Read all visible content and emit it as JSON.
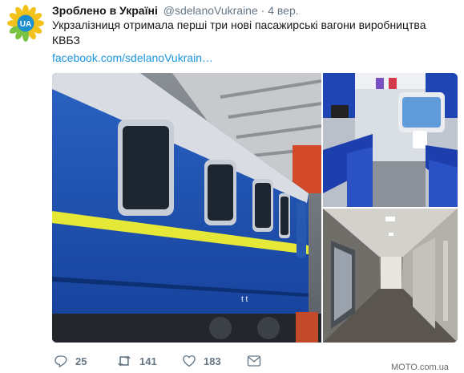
{
  "tweet": {
    "author_name": "Зроблено в Україні",
    "author_handle": "@sdelanoVukraine",
    "separator": "·",
    "time": "4 вер.",
    "avatar_text": "UA",
    "text_line_1": "Укрзалізниця отримала перші три нові пасажирські вагони виробництва",
    "text_line_2": "КВБЗ",
    "link": "facebook.com/sdelanoVukrain…",
    "photos": [
      {
        "name": "blue-passenger-railcar-exterior"
      },
      {
        "name": "compartment-interior-blue-seats"
      },
      {
        "name": "railcar-corridor-interior"
      }
    ],
    "car_side_lettering": "t   t"
  },
  "actions": {
    "reply": {
      "icon": "reply-icon",
      "count": "25"
    },
    "retweet": {
      "icon": "retweet-icon",
      "count": "141"
    },
    "like": {
      "icon": "heart-icon",
      "count": "183"
    },
    "message": {
      "icon": "envelope-icon"
    }
  },
  "watermark": "MOTO.com.ua",
  "colors": {
    "link": "#1b95e0",
    "meta_gray": "#657786",
    "railcar_blue": "#1b4fa3",
    "railcar_stripe": "#e5e836",
    "avatar_blue": "#1c8fd0",
    "avatar_yellow": "#f2c21b"
  }
}
